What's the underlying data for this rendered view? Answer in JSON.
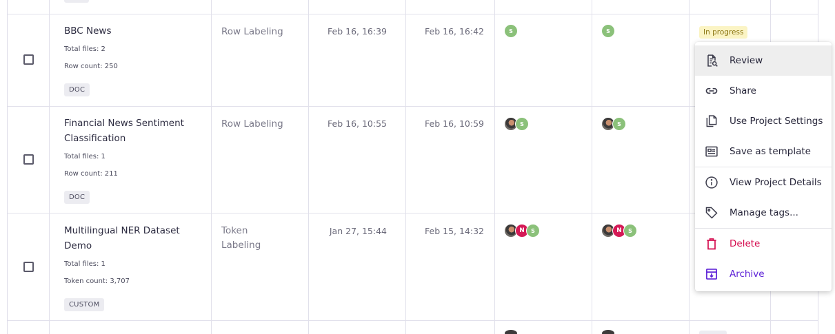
{
  "rows": [
    {
      "name": "BBC News",
      "total_files": "Total files: 2",
      "count": "Row count: 250",
      "tag": "DOC",
      "type": "Row Labeling",
      "created": "Feb 16, 16:39",
      "updated": "Feb 16, 16:42",
      "annotators": [
        "S"
      ],
      "reviewers": [
        "S"
      ],
      "status": "In progress"
    },
    {
      "name": "Financial News Sentiment Classification",
      "total_files": "Total files: 1",
      "count": "Row count: 211",
      "tag": "DOC",
      "type": "Row Labeling",
      "created": "Feb 16, 10:55",
      "updated": "Feb 16, 10:59",
      "annotators": [
        "photo",
        "S"
      ],
      "reviewers": [
        "photo",
        "S"
      ]
    },
    {
      "name": "Multilingual NER Dataset Demo",
      "total_files": "Total files: 1",
      "count": "Token count: 3,707",
      "tag": "CUSTOM",
      "type": "Token Labeling",
      "created": "Jan 27, 15:44",
      "updated": "Feb 15, 14:32",
      "annotators": [
        "photo",
        "N",
        "S"
      ],
      "reviewers": [
        "photo",
        "N",
        "S"
      ]
    }
  ],
  "menu": {
    "items": [
      {
        "label": "Review",
        "icon": "review-icon"
      },
      {
        "label": "Share",
        "icon": "link-icon"
      },
      {
        "label": "Use Project Settings",
        "icon": "copy-icon"
      },
      {
        "label": "Save as template",
        "icon": "template-icon"
      },
      {
        "label": "View Project Details",
        "icon": "info-icon"
      },
      {
        "label": "Manage tags...",
        "icon": "tag-icon"
      },
      {
        "label": "Delete",
        "icon": "trash-icon"
      },
      {
        "label": "Archive",
        "icon": "archive-icon"
      }
    ]
  },
  "colors": {
    "accent": "#5b1fd6",
    "danger": "#d4094c",
    "avatar_s": "#8bc17a",
    "avatar_n": "#d41a56",
    "status_bg": "#fbf4c4"
  }
}
